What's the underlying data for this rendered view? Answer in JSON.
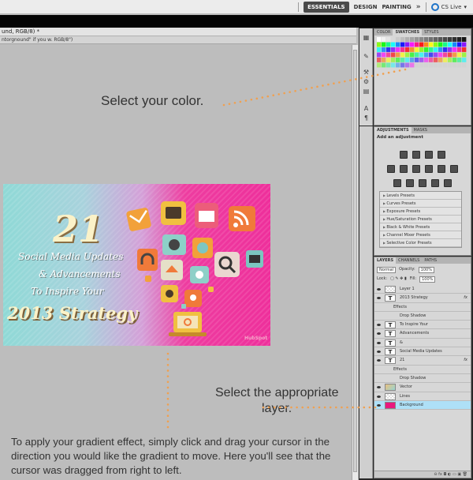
{
  "workspace": {
    "active": "ESSENTIALS",
    "items": [
      "DESIGN",
      "PAINTING"
    ],
    "more": "»",
    "cs_live": "CS Live"
  },
  "document": {
    "title": "und, RGB/8) *",
    "hint": "ntorgnound\" if you w. RGB/8\")"
  },
  "artwork": {
    "big_number": "21",
    "line1": "Social Media Updates",
    "line2": "& Advancements",
    "line3": "To Inspire Your",
    "year_line": "2013 Strategy",
    "brand": "HubSpot"
  },
  "annotations": {
    "select_color": "Select your color.",
    "select_layer_1": "Select the appropriate",
    "select_layer_2": "layer.",
    "instructions": "To apply your gradient effect, simply click and drag your cursor in the direction you would like the gradient to move. Here you'll see that the cursor was dragged from right to left."
  },
  "color_panel": {
    "tabs": [
      "COLOR",
      "SWATCHES",
      "STYLES"
    ]
  },
  "adjustments_panel": {
    "tabs": [
      "ADJUSTMENTS",
      "MASKS"
    ],
    "title": "Add an adjustment",
    "presets": [
      "Levels Presets",
      "Curves Presets",
      "Exposure Presets",
      "Hue/Saturation Presets",
      "Black & White Presets",
      "Channel Mixer Presets",
      "Selective Color Presets"
    ]
  },
  "layers_panel": {
    "tabs": [
      "LAYERS",
      "CHANNELS",
      "PATHS"
    ],
    "blend_mode": "Normal",
    "opacity_label": "Opacity:",
    "opacity_value": "100%",
    "lock_label": "Lock:",
    "fill_label": "Fill:",
    "fill_value": "100%",
    "fx_label": "fx",
    "layers": [
      {
        "name": "Layer 1",
        "kind": "empty"
      },
      {
        "name": "2013 Strategy",
        "kind": "text",
        "fx": true
      },
      {
        "name": "Effects",
        "kind": "effects"
      },
      {
        "name": "Drop Shadow",
        "kind": "effect-item"
      },
      {
        "name": "To Inspire Your",
        "kind": "text"
      },
      {
        "name": "Advancements",
        "kind": "text"
      },
      {
        "name": "&",
        "kind": "text"
      },
      {
        "name": "Social Media Updates",
        "kind": "text"
      },
      {
        "name": "21",
        "kind": "text",
        "fx": true
      },
      {
        "name": "Effects",
        "kind": "effects"
      },
      {
        "name": "Drop Shadow",
        "kind": "effect-item"
      },
      {
        "name": "Vector",
        "kind": "vector"
      },
      {
        "name": "Lines",
        "kind": "empty"
      },
      {
        "name": "Background",
        "kind": "background",
        "selected": true
      }
    ]
  },
  "colors": {
    "selected_layer": "#aee0f7",
    "annotation_dots": "#f0a050",
    "artwork_pink": "#ee2f9b",
    "artwork_teal": "#8fd9d6"
  }
}
